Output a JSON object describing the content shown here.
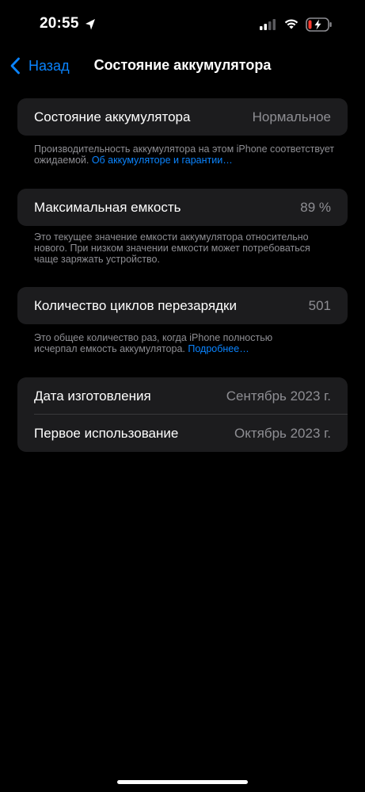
{
  "status_bar": {
    "time": "20:55",
    "location_icon": "location-arrow-icon",
    "signal_icon": "cellular-signal-icon",
    "wifi_icon": "wifi-icon",
    "battery_icon": "battery-charging-icon",
    "battery_low_color": "#ff3b30"
  },
  "nav": {
    "back_label": "Назад",
    "title": "Состояние аккумулятора"
  },
  "health": {
    "label": "Состояние аккумулятора",
    "value": "Нормальное",
    "footnote_text": "Производительность аккумулятора на этом iPhone соответствует ожидаемой. ",
    "footnote_link": "Об аккумуляторе и гарантии…"
  },
  "capacity": {
    "label": "Максимальная емкость",
    "value": "89 %",
    "footnote_text": "Это текущее значение емкости аккумулятора относительно нового. При низком значении емкости может потребоваться чаще заряжать устройство."
  },
  "cycles": {
    "label": "Количество циклов перезарядки",
    "value": "501",
    "footnote_text": "Это общее количество раз, когда iPhone полностью исчерпал емкость аккумулятора. ",
    "footnote_link": "Подробнее…"
  },
  "dates": {
    "manufacture_label": "Дата изготовления",
    "manufacture_value": "Сентябрь 2023 г.",
    "first_use_label": "Первое использование",
    "first_use_value": "Октябрь 2023 г."
  },
  "colors": {
    "accent": "#0a84ff",
    "card_bg": "#1c1c1e",
    "secondary_text": "#8e8e93"
  }
}
